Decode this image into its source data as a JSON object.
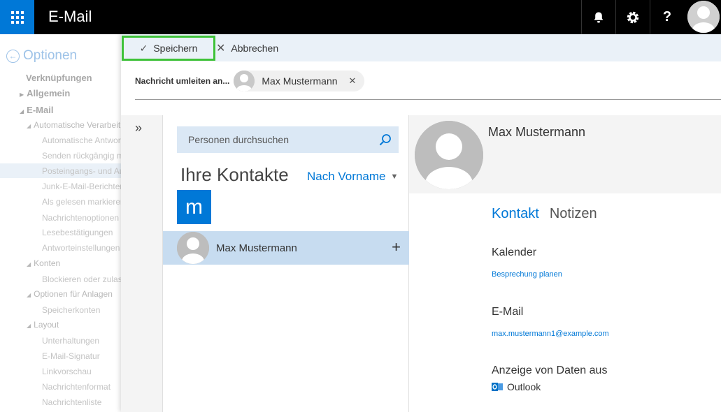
{
  "topbar": {
    "app_title": "E-Mail",
    "brand_color": "#0078d7",
    "icons": [
      "waffle-icon",
      "bell-icon",
      "gear-icon",
      "help-icon"
    ],
    "help_glyph": "?"
  },
  "options": {
    "title": "Optionen",
    "items": [
      {
        "label": "Verknüpfungen",
        "level": 1
      },
      {
        "label": "Allgemein",
        "level": 1
      },
      {
        "label": "E-Mail",
        "level": 1
      },
      {
        "label": "Automatische Verarbeitung",
        "level": 2
      },
      {
        "label": "Automatische Antworten",
        "level": 3
      },
      {
        "label": "Senden rückgängig machen",
        "level": 3
      },
      {
        "label": "Posteingangs- und Aufräumregeln",
        "level": 3
      },
      {
        "label": "Junk-E-Mail-Berichterstattung",
        "level": 3
      },
      {
        "label": "Als gelesen markieren",
        "level": 3
      },
      {
        "label": "Nachrichtenoptionen",
        "level": 3
      },
      {
        "label": "Lesebestätigungen",
        "level": 3
      },
      {
        "label": "Antworteinstellungen",
        "level": 3
      },
      {
        "label": "Konten",
        "level": 2
      },
      {
        "label": "Blockieren oder zulassen",
        "level": 3
      },
      {
        "label": "Optionen für Anlagen",
        "level": 2
      },
      {
        "label": "Speicherkonten",
        "level": 3
      },
      {
        "label": "Layout",
        "level": 2
      },
      {
        "label": "Unterhaltungen",
        "level": 3
      },
      {
        "label": "E-Mail-Signatur",
        "level": 3
      },
      {
        "label": "Linkvorschau",
        "level": 3
      },
      {
        "label": "Nachrichtenformat",
        "level": 3
      },
      {
        "label": "Nachrichtenliste",
        "level": 3
      }
    ]
  },
  "command_bar": {
    "save_label": "Speichern",
    "cancel_label": "Abbrechen"
  },
  "redirect": {
    "label": "Nachricht umleiten an...",
    "recipient": "Max Mustermann"
  },
  "picker": {
    "search_placeholder": "Personen durchsuchen",
    "title": "Ihre Kontakte",
    "sort_label": "Nach Vorname",
    "letter": "m",
    "contacts": [
      {
        "name": "Max Mustermann"
      }
    ]
  },
  "detail": {
    "name": "Max Mustermann",
    "tab_contact": "Kontakt",
    "tab_notes": "Notizen",
    "calendar_title": "Kalender",
    "calendar_link": "Besprechung planen",
    "email_title": "E-Mail",
    "email_value": "max.mustermann1@example.com",
    "source_title": "Anzeige von Daten aus",
    "source_value": "Outlook"
  }
}
